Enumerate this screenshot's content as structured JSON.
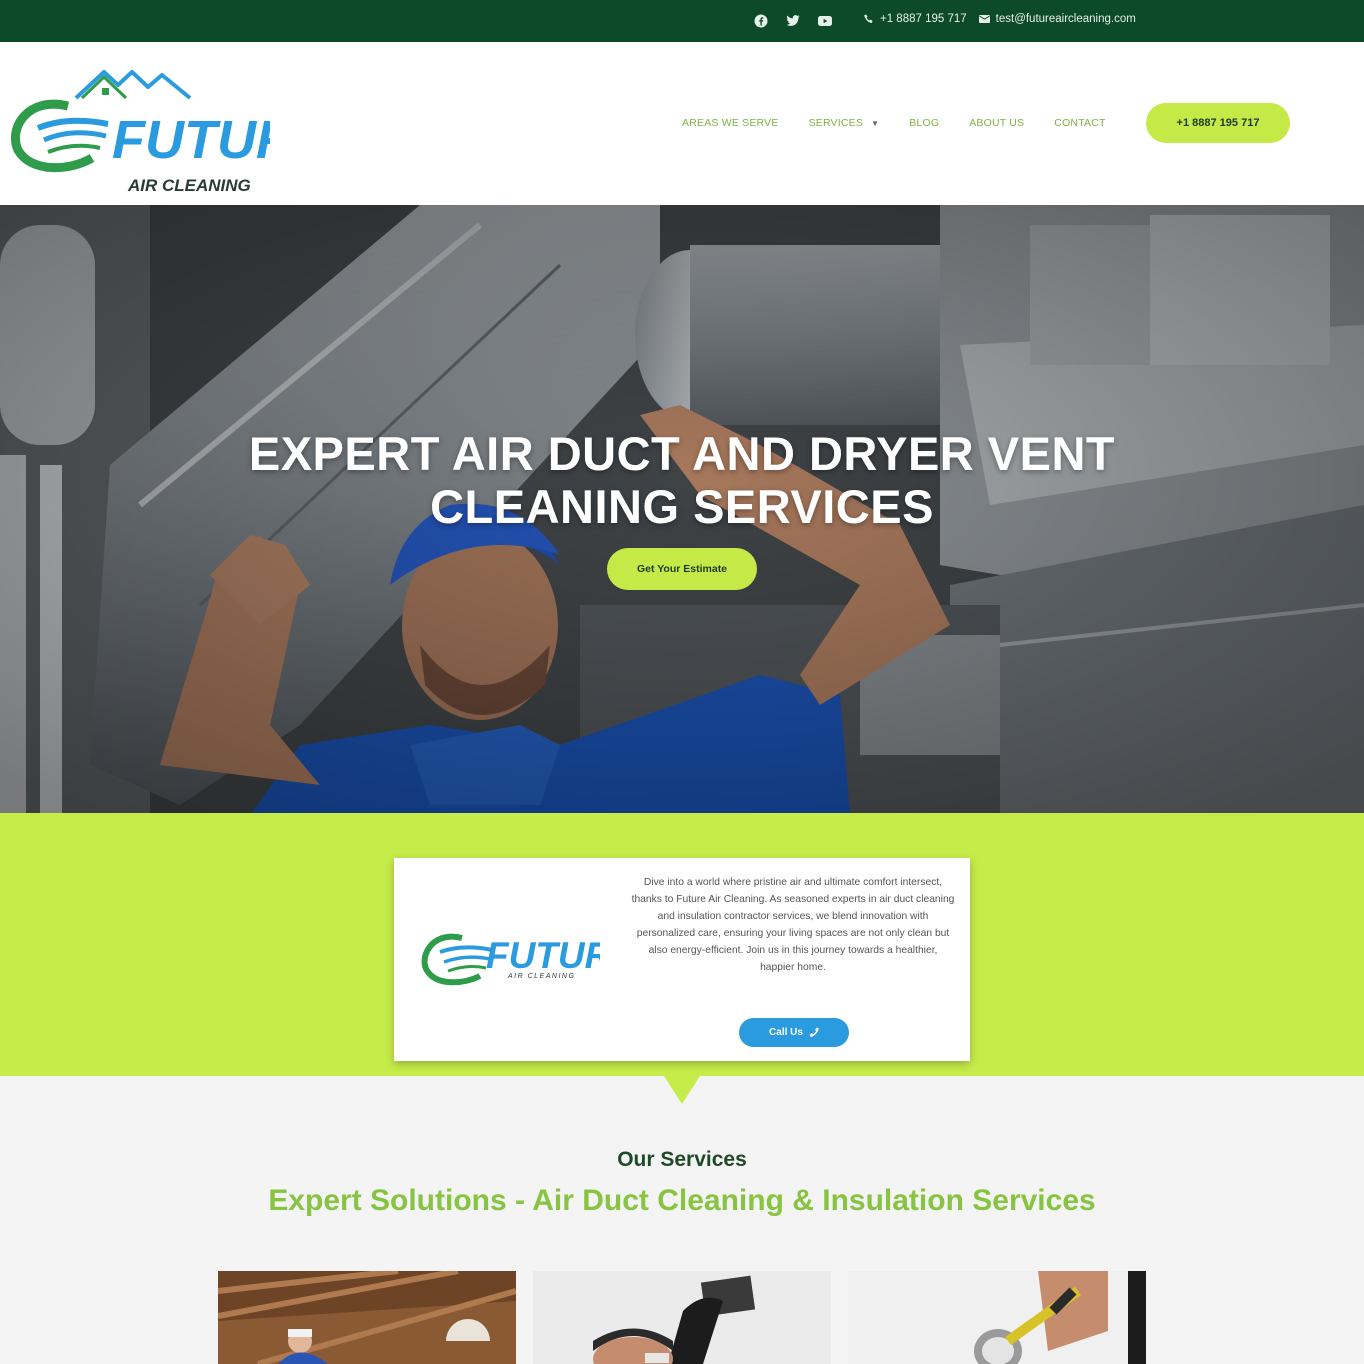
{
  "topbar": {
    "social": [
      "facebook-icon",
      "twitter-icon",
      "youtube-icon"
    ],
    "phone": "+1 8887 195 717",
    "email": "test@futureaircleaning.com"
  },
  "brand": {
    "name": "FUTURE",
    "tagline": "AIR CLEANING",
    "green": "#2e9c4a",
    "blue": "#2b9be0",
    "lime": "#c6ec4a",
    "dark_green": "#0d4a2a"
  },
  "nav": {
    "items": [
      "AREAS WE SERVE",
      "SERVICES",
      "BLOG",
      "ABOUT US",
      "CONTACT"
    ],
    "phone_button": "+1 8887 195 717"
  },
  "hero": {
    "title_line1": "EXPERT AIR DUCT AND DRYER VENT",
    "title_line2": "CLEANING SERVICES",
    "cta": "Get Your Estimate"
  },
  "intro": {
    "text": "Dive into a world where pristine air and ultimate comfort intersect, thanks to Future Air Cleaning. As seasoned experts in air duct cleaning and insulation contractor services, we blend innovation with personalized care, ensuring your living spaces are not only clean but also energy-efficient. Join us in this journey towards a healthier, happier home.",
    "call_button": "Call Us"
  },
  "services": {
    "eyebrow": "Our Services",
    "title": "Expert Solutions - Air Duct Cleaning & Insulation Services"
  }
}
